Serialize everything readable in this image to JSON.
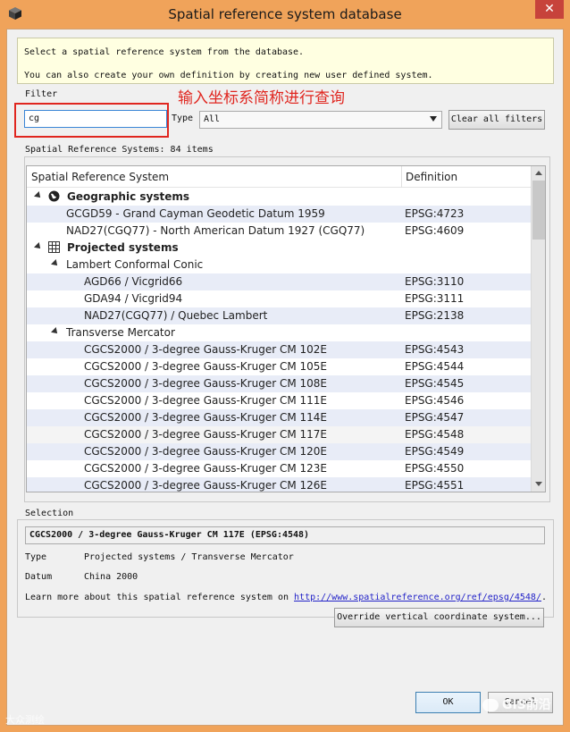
{
  "window": {
    "title": "Spatial reference system database",
    "close_glyph": "✕"
  },
  "info": {
    "line1": "Select a spatial reference system from the database.",
    "line2": "You can also create your own definition by creating new user defined system."
  },
  "filter": {
    "label": "Filter",
    "value": "cg",
    "annotation": "输入坐标系简称进行查询"
  },
  "type_filter": {
    "label": "Type",
    "selected": "All"
  },
  "clear_button": "Clear all filters",
  "srs": {
    "group_label": "Spatial Reference Systems: 84 items",
    "col_system": "Spatial Reference System",
    "col_definition": "Definition",
    "rows": [
      {
        "kind": "group",
        "name": "Geographic systems",
        "code": "",
        "icon": "globe-icon"
      },
      {
        "kind": "item",
        "name": "GCGD59 - Grand Cayman Geodetic Datum 1959",
        "code": "EPSG:4723"
      },
      {
        "kind": "item",
        "name": "NAD27(CGQ77) - North American Datum 1927 (CGQ77)",
        "code": "EPSG:4609"
      },
      {
        "kind": "group",
        "name": "Projected systems",
        "code": "",
        "icon": "grid-icon"
      },
      {
        "kind": "sub",
        "name": "Lambert Conformal Conic",
        "code": ""
      },
      {
        "kind": "leaf",
        "name": "AGD66 / Vicgrid66",
        "code": "EPSG:3110"
      },
      {
        "kind": "leaf",
        "name": "GDA94 / Vicgrid94",
        "code": "EPSG:3111"
      },
      {
        "kind": "leaf",
        "name": "NAD27(CGQ77) / Quebec Lambert",
        "code": "EPSG:2138"
      },
      {
        "kind": "sub",
        "name": "Transverse Mercator",
        "code": ""
      },
      {
        "kind": "leaf",
        "name": "CGCS2000 / 3-degree Gauss-Kruger CM 102E",
        "code": "EPSG:4543"
      },
      {
        "kind": "leaf",
        "name": "CGCS2000 / 3-degree Gauss-Kruger CM 105E",
        "code": "EPSG:4544"
      },
      {
        "kind": "leaf",
        "name": "CGCS2000 / 3-degree Gauss-Kruger CM 108E",
        "code": "EPSG:4545"
      },
      {
        "kind": "leaf",
        "name": "CGCS2000 / 3-degree Gauss-Kruger CM 111E",
        "code": "EPSG:4546"
      },
      {
        "kind": "leaf",
        "name": "CGCS2000 / 3-degree Gauss-Kruger CM 114E",
        "code": "EPSG:4547"
      },
      {
        "kind": "leaf",
        "name": "CGCS2000 / 3-degree Gauss-Kruger CM 117E",
        "code": "EPSG:4548",
        "selected": true
      },
      {
        "kind": "leaf",
        "name": "CGCS2000 / 3-degree Gauss-Kruger CM 120E",
        "code": "EPSG:4549"
      },
      {
        "kind": "leaf",
        "name": "CGCS2000 / 3-degree Gauss-Kruger CM 123E",
        "code": "EPSG:4550"
      },
      {
        "kind": "leaf",
        "name": "CGCS2000 / 3-degree Gauss-Kruger CM 126E",
        "code": "EPSG:4551"
      }
    ]
  },
  "selection": {
    "group_label": "Selection",
    "name": "CGCS2000 / 3-degree Gauss-Kruger CM 117E (EPSG:4548)",
    "type_key": "Type",
    "type_value": "Projected systems / Transverse Mercator",
    "datum_key": "Datum",
    "datum_value": "China 2000",
    "learn_prefix": "Learn more about this spatial reference system on ",
    "learn_link": "http://www.spatialreference.org/ref/epsg/4548/",
    "learn_suffix": ".",
    "override_button": "Override vertical coordinate system..."
  },
  "buttons": {
    "ok": "OK",
    "cancel": "Cancel"
  },
  "watermarks": {
    "left": "大众测绘",
    "right": "GIS前沿"
  }
}
